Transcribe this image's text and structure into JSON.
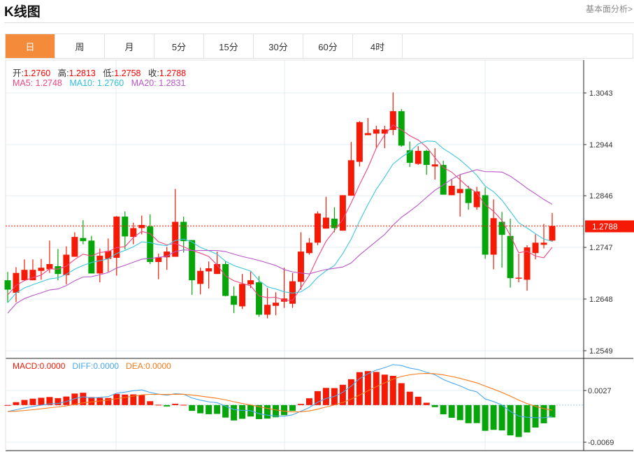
{
  "header": {
    "title": "K线图",
    "link": "基本面分析>"
  },
  "tabs": [
    {
      "label": "日",
      "active": true
    },
    {
      "label": "周"
    },
    {
      "label": "月"
    },
    {
      "label": "5分"
    },
    {
      "label": "15分"
    },
    {
      "label": "30分"
    },
    {
      "label": "60分"
    },
    {
      "label": "4时"
    }
  ],
  "ohlc": {
    "open_label": "开:",
    "open": "1.2760",
    "high_label": "高:",
    "high": "1.2813",
    "low_label": "低:",
    "low": "1.2758",
    "close_label": "收:",
    "close": "1.2788"
  },
  "ma": {
    "ma5": "MA5: 1.2748",
    "ma10": "MA10: 1.2760",
    "ma20": "MA20: 1.2831"
  },
  "macd_legend": {
    "macd": "MACD:0.0000",
    "diff": "DIFF:0.0000",
    "dea": "DEA:0.0000"
  },
  "colors": {
    "up": "#f41a05",
    "down": "#06a50a",
    "ma5": "#f0457f",
    "ma10": "#3cc6de",
    "ma20": "#b857c8",
    "diff": "#4aa8ee",
    "dea": "#f97a1a",
    "accent": "#f38b3b"
  },
  "chart_data": {
    "type": "candlestick",
    "price_ticks": [
      "1.3043",
      "1.2944",
      "1.2846",
      "1.2747",
      "1.2648",
      "1.2549"
    ],
    "ylim": [
      1.2549,
      1.3043
    ],
    "last_price": "1.2788",
    "macd_ticks": [
      "0.0027",
      "-0.0069"
    ],
    "macd_ylim": [
      -0.0069,
      0.0027
    ],
    "candles_ohlc": [
      [
        1.2684,
        1.27,
        1.2641,
        1.2666
      ],
      [
        1.266,
        1.2709,
        1.2642,
        1.2698
      ],
      [
        1.2684,
        1.2724,
        1.2684,
        1.2704
      ],
      [
        1.2684,
        1.2724,
        1.2684,
        1.2704
      ],
      [
        1.2702,
        1.2725,
        1.2685,
        1.2708
      ],
      [
        1.2705,
        1.276,
        1.2698,
        1.2715
      ],
      [
        1.2711,
        1.2744,
        1.2684,
        1.2696
      ],
      [
        1.2694,
        1.2749,
        1.2676,
        1.2733
      ],
      [
        1.2729,
        1.2776,
        1.2729,
        1.2767
      ],
      [
        1.2765,
        1.2799,
        1.2753,
        1.2759
      ],
      [
        1.276,
        1.2769,
        1.2697,
        1.2697
      ],
      [
        1.2697,
        1.2745,
        1.268,
        1.2731
      ],
      [
        1.2725,
        1.2764,
        1.27,
        1.274
      ],
      [
        1.2727,
        1.2807,
        1.2693,
        1.2806
      ],
      [
        1.2806,
        1.2816,
        1.2743,
        1.2768
      ],
      [
        1.2767,
        1.2794,
        1.2753,
        1.2784
      ],
      [
        1.2784,
        1.2808,
        1.2772,
        1.279
      ],
      [
        1.2787,
        1.281,
        1.2715,
        1.2719
      ],
      [
        1.2719,
        1.2735,
        1.2686,
        1.2728
      ],
      [
        1.2728,
        1.2748,
        1.2704,
        1.2739
      ],
      [
        1.2729,
        1.2859,
        1.2729,
        1.2796
      ],
      [
        1.2796,
        1.2806,
        1.2737,
        1.2759
      ],
      [
        1.2761,
        1.2761,
        1.2656,
        1.2684
      ],
      [
        1.2677,
        1.2708,
        1.2657,
        1.2702
      ],
      [
        1.2701,
        1.272,
        1.2668,
        1.2707
      ],
      [
        1.2696,
        1.2739,
        1.2696,
        1.2715
      ],
      [
        1.2715,
        1.272,
        1.2653,
        1.2654
      ],
      [
        1.2654,
        1.2672,
        1.2621,
        1.2637
      ],
      [
        1.2634,
        1.2696,
        1.2629,
        1.2677
      ],
      [
        1.2676,
        1.2701,
        1.2669,
        1.2684
      ],
      [
        1.268,
        1.2692,
        1.2614,
        1.2618
      ],
      [
        1.2618,
        1.2669,
        1.2611,
        1.2637
      ],
      [
        1.2635,
        1.2661,
        1.2617,
        1.2641
      ],
      [
        1.2643,
        1.2708,
        1.2631,
        1.2649
      ],
      [
        1.2639,
        1.2698,
        1.2631,
        1.2682
      ],
      [
        1.2681,
        1.2776,
        1.2666,
        1.2739
      ],
      [
        1.2736,
        1.2765,
        1.2733,
        1.2756
      ],
      [
        1.2756,
        1.2816,
        1.2751,
        1.2812
      ],
      [
        1.2783,
        1.2844,
        1.2783,
        1.2804
      ],
      [
        1.2802,
        1.2824,
        1.2776,
        1.2784
      ],
      [
        1.2779,
        1.2847,
        1.2779,
        1.2847
      ],
      [
        1.2846,
        1.2949,
        1.2846,
        1.2914
      ],
      [
        1.2911,
        1.2989,
        1.2902,
        1.2987
      ],
      [
        1.2962,
        1.2995,
        1.2962,
        1.2966
      ],
      [
        1.2965,
        1.298,
        1.2938,
        1.2973
      ],
      [
        1.2965,
        1.298,
        1.2937,
        1.2973
      ],
      [
        1.2972,
        1.3044,
        1.2962,
        1.3008
      ],
      [
        1.3008,
        1.3012,
        1.294,
        1.2942
      ],
      [
        1.2933,
        1.295,
        1.2901,
        1.2909
      ],
      [
        1.2907,
        1.2941,
        1.2905,
        1.2932
      ],
      [
        1.2932,
        1.2934,
        1.2886,
        1.2905
      ],
      [
        1.2902,
        1.2937,
        1.2877,
        1.2906
      ],
      [
        1.2905,
        1.2913,
        1.2848,
        1.2848
      ],
      [
        1.2847,
        1.2877,
        1.2847,
        1.2865
      ],
      [
        1.2851,
        1.2886,
        1.2806,
        1.2859
      ],
      [
        1.2859,
        1.2865,
        1.2819,
        1.2832
      ],
      [
        1.2824,
        1.2863,
        1.2819,
        1.2854
      ],
      [
        1.2847,
        1.2862,
        1.2725,
        1.2733
      ],
      [
        1.2733,
        1.2839,
        1.2705,
        1.2803
      ],
      [
        1.2796,
        1.2815,
        1.2708,
        1.2771
      ],
      [
        1.2769,
        1.2802,
        1.267,
        1.2688
      ],
      [
        1.2688,
        1.2735,
        1.268,
        1.2689
      ],
      [
        1.2685,
        1.2751,
        1.2664,
        1.2747
      ],
      [
        1.2736,
        1.2772,
        1.2724,
        1.2756
      ],
      [
        1.2752,
        1.2792,
        1.2745,
        1.2756
      ],
      [
        1.276,
        1.2813,
        1.2758,
        1.2788
      ]
    ]
  }
}
